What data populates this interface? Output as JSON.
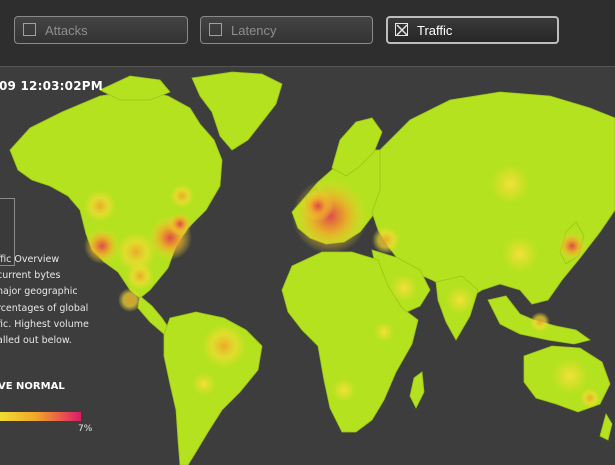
{
  "toggles": [
    {
      "label": "Attacks",
      "checked": false
    },
    {
      "label": "Latency",
      "checked": false
    },
    {
      "label": "Traffic",
      "checked": true
    }
  ],
  "info": {
    "timestamp": "09 12:03:02PM",
    "description": "ffic Overview\n current bytes\nnajor geographic\nrcentages of global\nfic. Highest volume\nalled out below.",
    "legend_label": "VE NORMAL",
    "legend_max": "7%"
  },
  "colors": {
    "background": "#3d3d3d",
    "land": "#b4e21e",
    "heat_low": "#f2dc33",
    "heat_mid": "#f0a52a",
    "heat_high": "#e0424c"
  }
}
